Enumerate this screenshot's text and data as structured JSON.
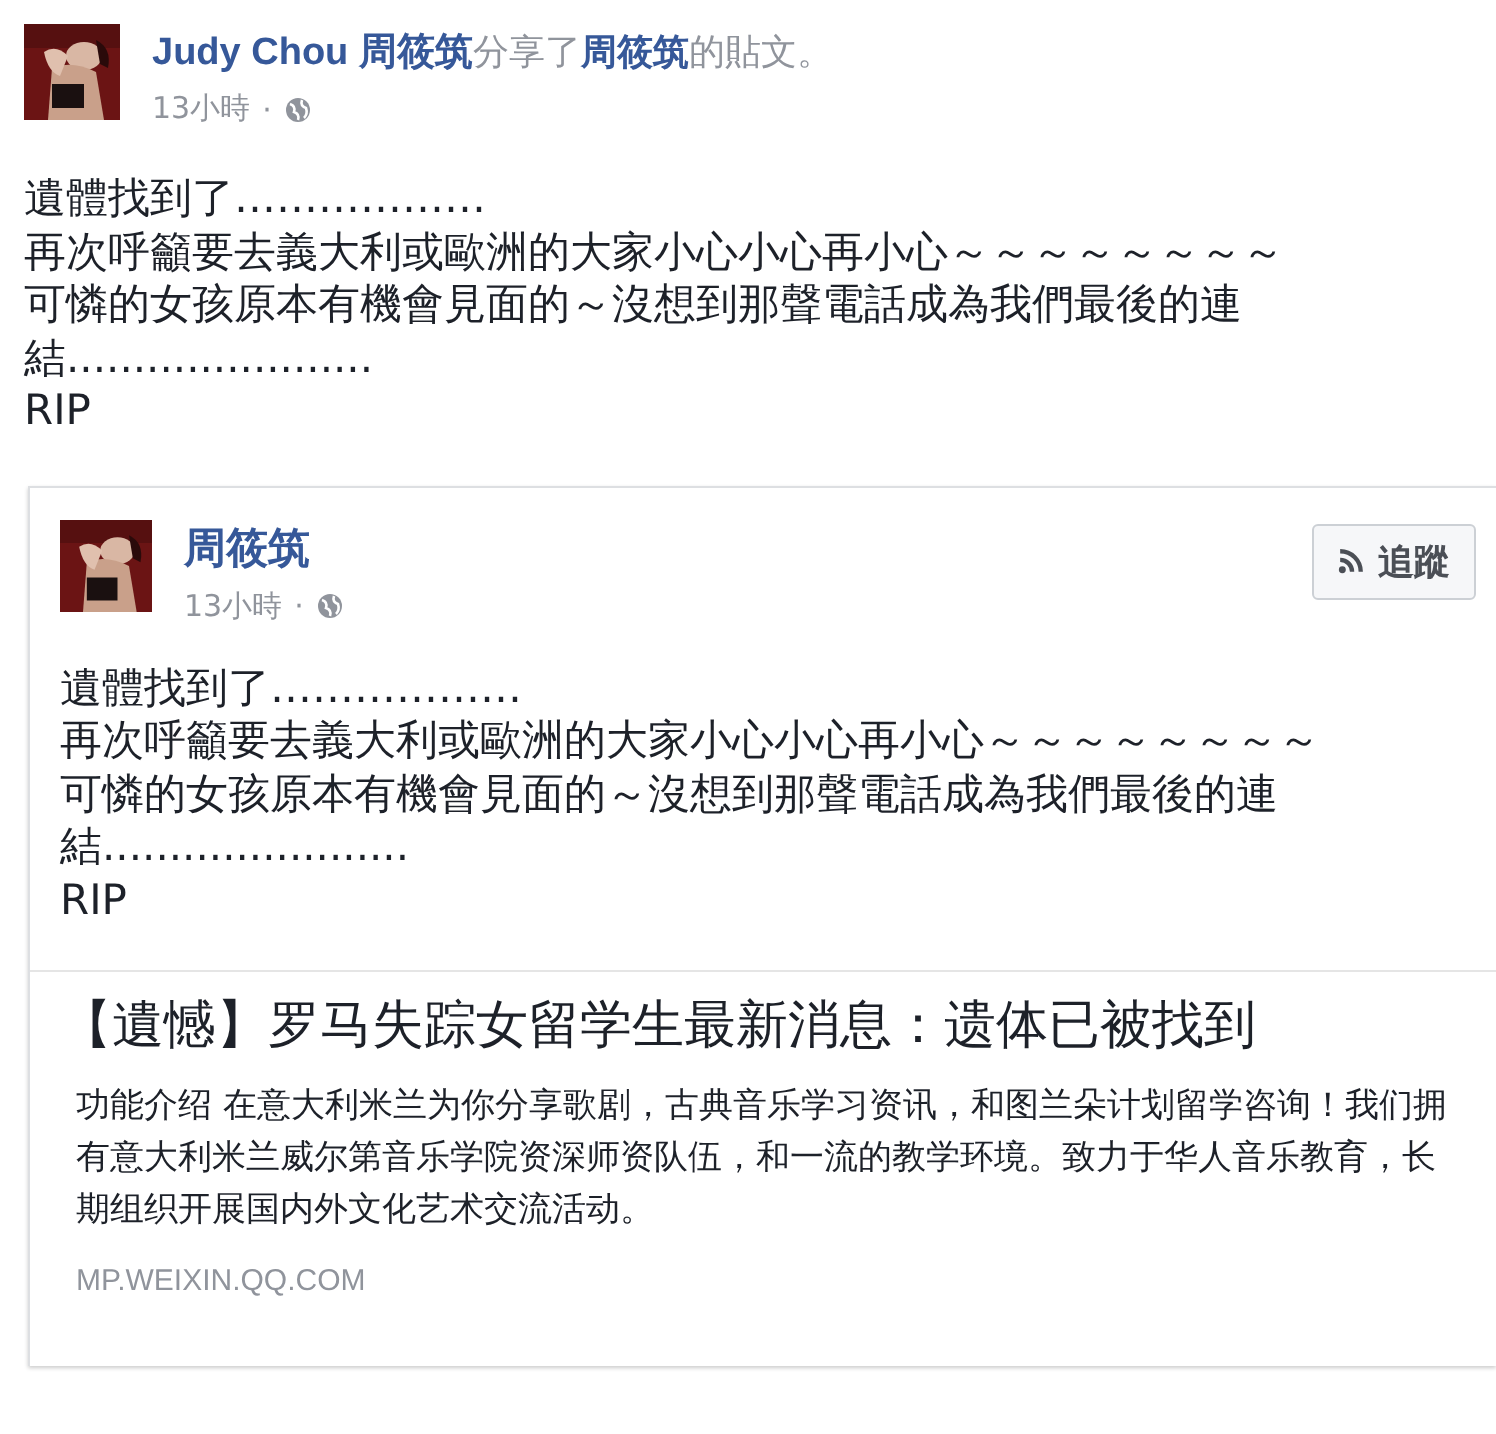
{
  "post": {
    "author": "Judy Chou 周筱筑",
    "action": "分享了",
    "original_author": "周筱筑",
    "suffix": "的貼文。",
    "time": "13小時",
    "separator": "·",
    "lines": [
      "遺體找到了………………",
      "再次呼籲要去義大利或歐洲的大家小心小心再小心～～～～～～～～",
      "可憐的女孩原本有機會見面的～沒想到那聲電話成為我們最後的連",
      "結.......................",
      "RIP"
    ]
  },
  "shared_post": {
    "author": "周筱筑",
    "time": "13小時",
    "separator": "·",
    "follow_button": "追蹤",
    "lines": [
      "遺體找到了………………",
      "再次呼籲要去義大利或歐洲的大家小心小心再小心～～～～～～～～",
      "可憐的女孩原本有機會見面的～沒想到那聲電話成為我們最後的連",
      "結.......................",
      "RIP"
    ],
    "link": {
      "title": "【遺憾】罗马失踪女留学生最新消息：遗体已被找到",
      "description": "功能介绍 在意大利米兰为你分享歌剧，古典音乐学习资讯，和图兰朵计划留学咨询！我们拥有意大利米兰威尔第音乐学院资深师资队伍，和一流的教学环境。致力于华人音乐教育，长期组织开展国内外文化艺术交流活动。",
      "domain": "MP.WEIXIN.QQ.COM"
    }
  }
}
